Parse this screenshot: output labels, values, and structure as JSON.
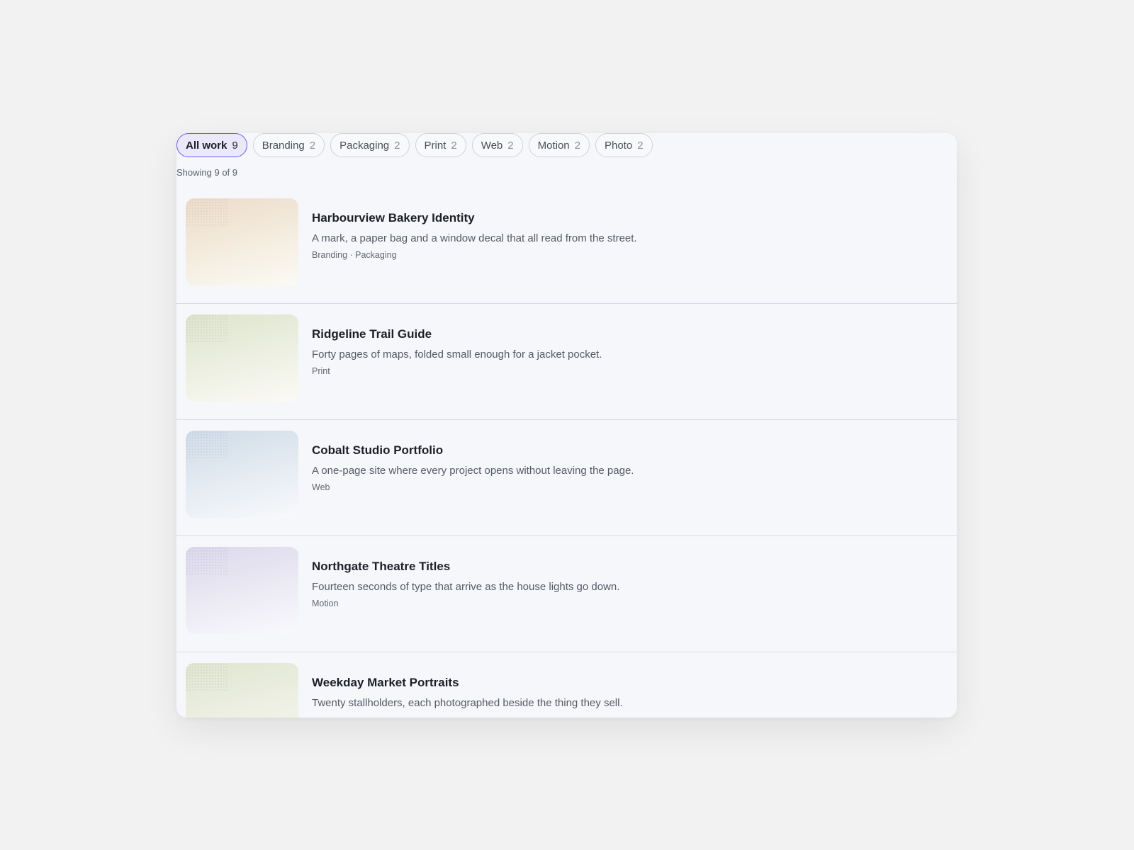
{
  "filters": [
    {
      "label": "All work",
      "count": "9",
      "active": true
    },
    {
      "label": "Branding",
      "count": "2",
      "active": false
    },
    {
      "label": "Packaging",
      "count": "2",
      "active": false
    },
    {
      "label": "Print",
      "count": "2",
      "active": false
    },
    {
      "label": "Web",
      "count": "2",
      "active": false
    },
    {
      "label": "Motion",
      "count": "2",
      "active": false
    },
    {
      "label": "Photo",
      "count": "2",
      "active": false
    }
  ],
  "showing_text": "Showing 9 of 9",
  "projects": [
    {
      "title": "Harbourview Bakery Identity",
      "description": "A mark, a paper bag and a window decal that all read from the street.",
      "tags": "Branding · Packaging",
      "color_top": "#ecdcc8",
      "color_bottom": "#fbfaf3"
    },
    {
      "title": "Ridgeline Trail Guide",
      "description": "Forty pages of maps, folded small enough for a jacket pocket.",
      "tags": "Print",
      "color_top": "#dde4cc",
      "color_bottom": "#fbfaf5"
    },
    {
      "title": "Cobalt Studio Portfolio",
      "description": "A one-page site where every project opens without leaving the page.",
      "tags": "Web",
      "color_top": "#cfdce8",
      "color_bottom": "#f8f9fb"
    },
    {
      "title": "Northgate Theatre Titles",
      "description": "Fourteen seconds of type that arrive as the house lights go down.",
      "tags": "Motion",
      "color_top": "#dcd8eb",
      "color_bottom": "#f9f9fc"
    },
    {
      "title": "Weekday Market Portraits",
      "description": "Twenty stallholders, each photographed beside the thing they sell.",
      "tags": "",
      "color_top": "#e0e5d0",
      "color_bottom": "#f7f8f2"
    }
  ]
}
